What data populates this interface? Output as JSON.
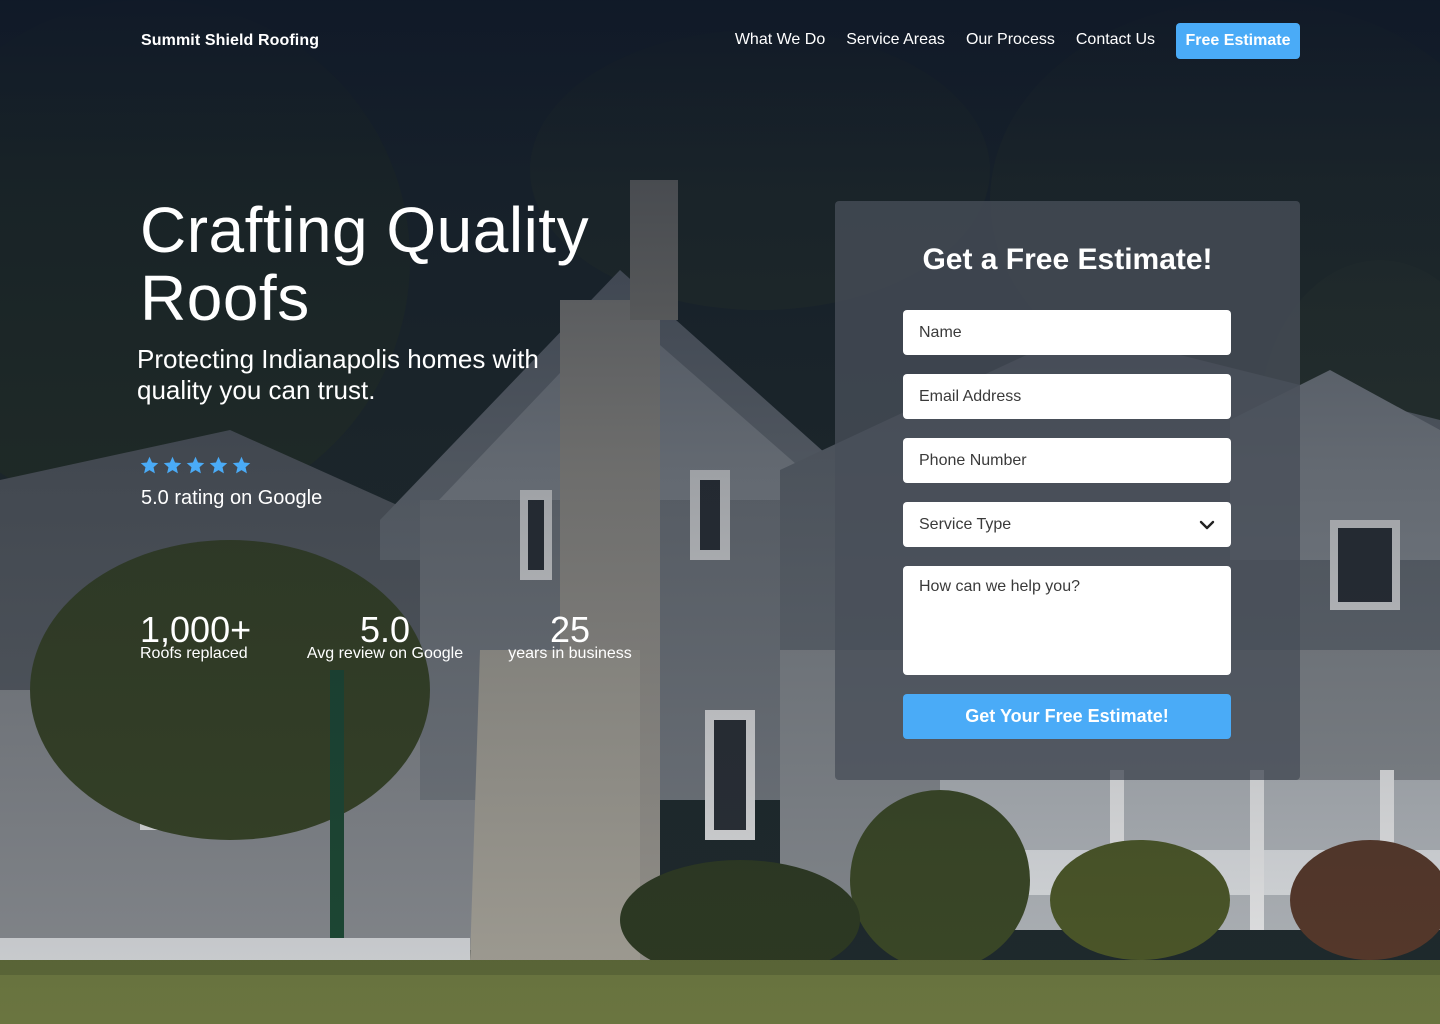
{
  "nav": {
    "brand": "Summit Shield Roofing",
    "links": [
      "What We Do",
      "Service Areas",
      "Our Process",
      "Contact Us"
    ],
    "cta": "Free Estimate"
  },
  "hero": {
    "title": "Crafting Quality Roofs",
    "subtitle": "Protecting Indianapolis homes with quality you can trust.",
    "rating": {
      "stars": 5,
      "text": "5.0 rating on Google"
    },
    "stats": [
      {
        "value": "1,000+",
        "label": "Roofs replaced"
      },
      {
        "value": "5.0",
        "label": "Avg review on Google"
      },
      {
        "value": "25",
        "label": "years in business"
      }
    ]
  },
  "form": {
    "title": "Get a Free Estimate!",
    "name_placeholder": "Name",
    "email_placeholder": "Email Address",
    "phone_placeholder": "Phone Number",
    "service_placeholder": "Service Type",
    "message_placeholder": "How can we help you?",
    "submit_label": "Get Your Free Estimate!"
  },
  "colors": {
    "accent": "#4aabf7",
    "panel": "#484e58",
    "overlay": "#0f1828"
  },
  "icons": {
    "star": "star-icon",
    "dropdown": "chevron-down-icon"
  }
}
